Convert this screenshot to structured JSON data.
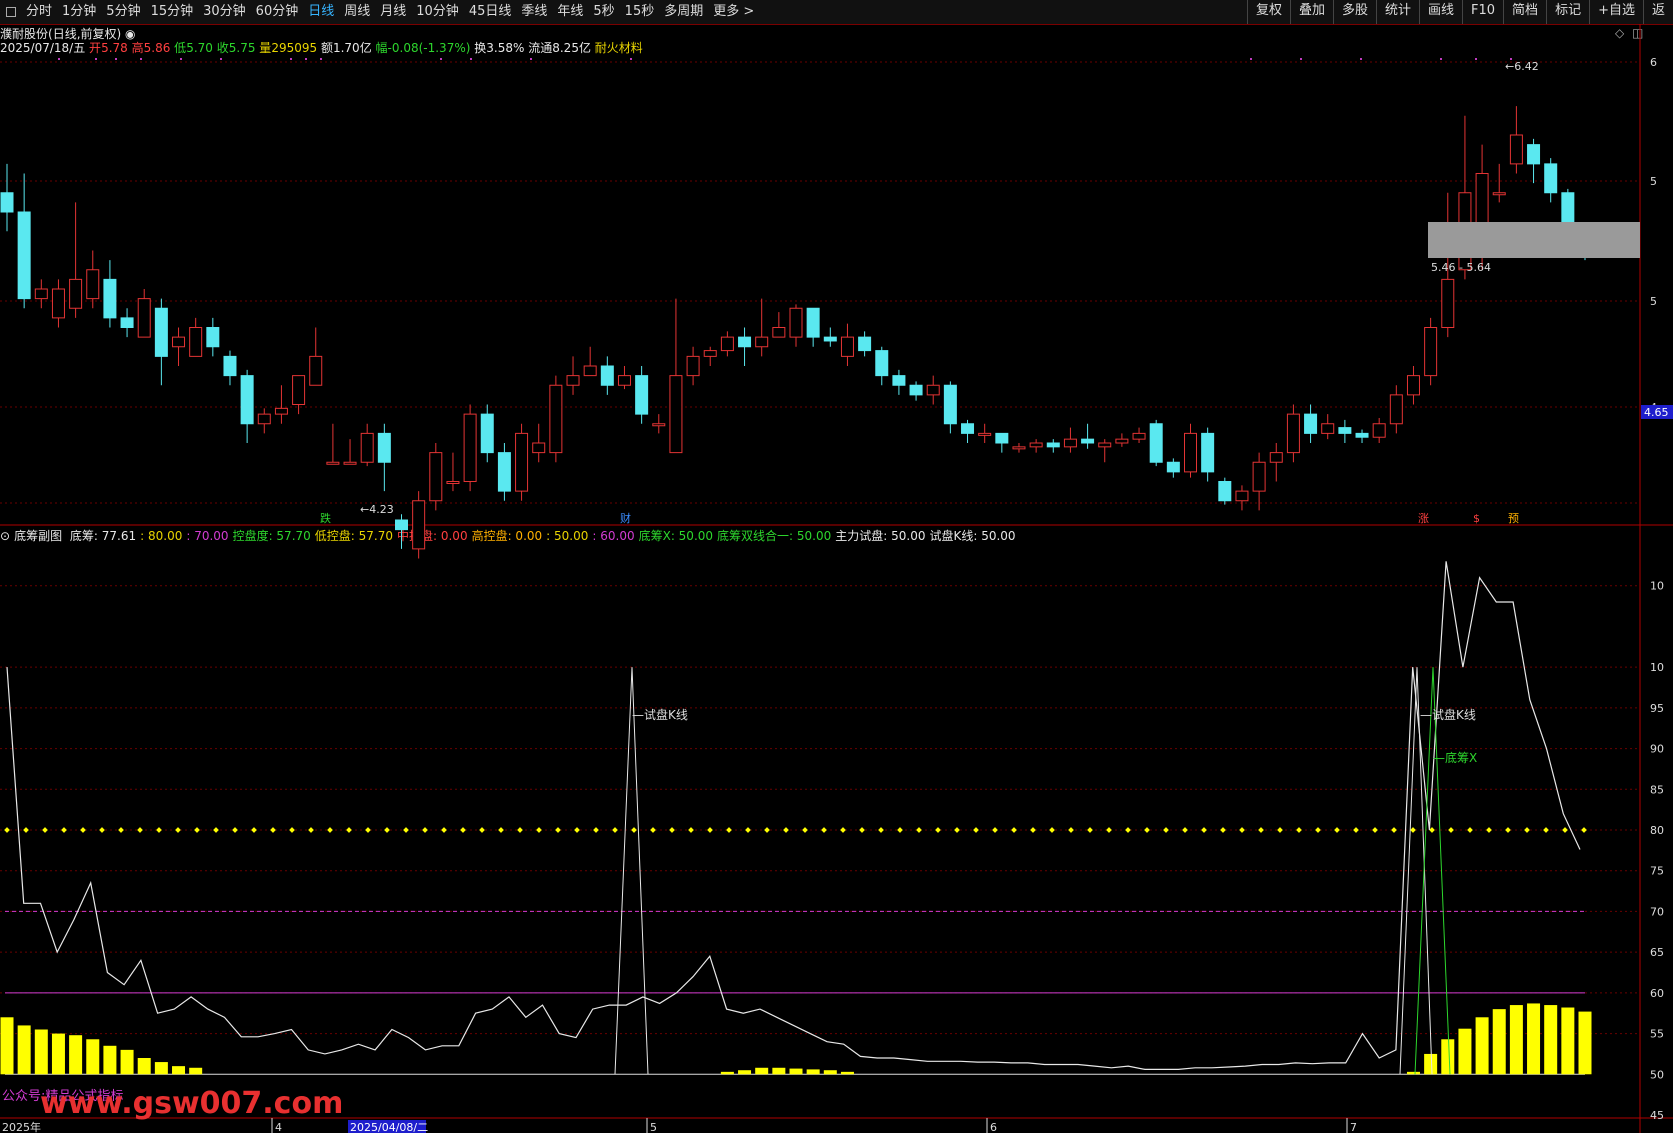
{
  "toolbar": {
    "periods": [
      "分时",
      "1分钟",
      "5分钟",
      "15分钟",
      "30分钟",
      "60分钟",
      "日线",
      "周线",
      "月线",
      "10分钟",
      "45日线",
      "季线",
      "年线",
      "5秒",
      "15秒",
      "多周期",
      "更多 >"
    ],
    "active": "日线",
    "right": [
      "复权",
      "叠加",
      "多股",
      "统计",
      "画线",
      "F10",
      "简档",
      "标记",
      "+自选",
      "返"
    ]
  },
  "stock": {
    "name": "濮耐股份",
    "mode": "(日线,前复权)",
    "date": "2025/07/18/五",
    "open_label": "开",
    "open": "5.78",
    "high_label": "高",
    "high": "5.86",
    "low_label": "低",
    "low": "5.70",
    "close_label": "收",
    "close": "5.75",
    "vol_label": "量",
    "vol": "295095",
    "amt_label": "额",
    "amt": "1.70亿",
    "chg_label": "幅",
    "chg": "-0.08(-1.37%)",
    "turnover_label": "换",
    "turnover": "3.58%",
    "float_label": "流通",
    "float": "8.25亿",
    "sector": "耐火材料"
  },
  "main_chart": {
    "price_labels": [
      "6",
      "5",
      "5",
      "4"
    ],
    "current_price": "4.65",
    "high_marker": "6.42",
    "low_marker": "4.23",
    "zone_label": "5.46 - 5.64",
    "markers": [
      "跌",
      "财",
      "涨",
      "$",
      "预"
    ],
    "y_domain": [
      4.1,
      6.5
    ],
    "candles": [
      [
        5.8,
        5.7,
        5.95,
        5.6
      ],
      [
        5.7,
        5.25,
        5.9,
        5.2
      ],
      [
        5.25,
        5.3,
        5.35,
        5.2
      ],
      [
        5.15,
        5.3,
        5.35,
        5.1
      ],
      [
        5.2,
        5.35,
        5.75,
        5.15
      ],
      [
        5.25,
        5.4,
        5.5,
        5.2
      ],
      [
        5.35,
        5.15,
        5.45,
        5.1
      ],
      [
        5.15,
        5.1,
        5.2,
        5.05
      ],
      [
        5.05,
        5.25,
        5.3,
        5.05
      ],
      [
        5.2,
        4.95,
        5.25,
        4.8
      ],
      [
        5.0,
        5.05,
        5.1,
        4.9
      ],
      [
        4.95,
        5.1,
        5.15,
        4.95
      ],
      [
        5.1,
        5.0,
        5.15,
        4.95
      ],
      [
        4.95,
        4.85,
        4.98,
        4.8
      ],
      [
        4.85,
        4.6,
        4.88,
        4.5
      ],
      [
        4.6,
        4.65,
        4.68,
        4.55
      ],
      [
        4.65,
        4.68,
        4.8,
        4.6
      ],
      [
        4.7,
        4.85,
        4.85,
        4.65
      ],
      [
        4.8,
        4.95,
        5.1,
        4.8
      ],
      [
        4.4,
        4.4,
        4.6,
        4.4
      ],
      [
        4.4,
        4.4,
        4.52,
        4.4
      ],
      [
        4.4,
        4.55,
        4.6,
        4.38
      ],
      [
        4.55,
        4.4,
        4.6,
        4.25
      ],
      [
        4.1,
        4.05,
        4.13,
        3.95
      ],
      [
        3.95,
        4.2,
        4.25,
        3.9
      ],
      [
        4.2,
        4.45,
        4.5,
        4.15
      ],
      [
        4.3,
        4.3,
        4.45,
        4.25
      ],
      [
        4.3,
        4.65,
        4.7,
        4.25
      ],
      [
        4.65,
        4.45,
        4.7,
        4.4
      ],
      [
        4.45,
        4.25,
        4.5,
        4.2
      ],
      [
        4.25,
        4.55,
        4.6,
        4.2
      ],
      [
        4.45,
        4.5,
        4.6,
        4.4
      ],
      [
        4.45,
        4.8,
        4.85,
        4.4
      ],
      [
        4.8,
        4.85,
        4.95,
        4.75
      ],
      [
        4.85,
        4.9,
        5.0,
        4.85
      ],
      [
        4.9,
        4.8,
        4.95,
        4.75
      ],
      [
        4.8,
        4.85,
        4.9,
        4.78
      ],
      [
        4.85,
        4.65,
        4.9,
        4.6
      ],
      [
        4.6,
        4.6,
        4.65,
        4.55
      ],
      [
        4.45,
        4.85,
        5.25,
        4.45
      ],
      [
        4.85,
        4.95,
        5.0,
        4.8
      ],
      [
        4.95,
        4.98,
        5.0,
        4.9
      ],
      [
        4.98,
        5.05,
        5.08,
        4.95
      ],
      [
        5.05,
        5.0,
        5.1,
        4.9
      ],
      [
        5.0,
        5.05,
        5.25,
        4.95
      ],
      [
        5.05,
        5.1,
        5.18,
        5.05
      ],
      [
        5.05,
        5.2,
        5.22,
        5.0
      ],
      [
        5.2,
        5.05,
        5.2,
        5.0
      ],
      [
        5.05,
        5.03,
        5.1,
        5.0
      ],
      [
        4.95,
        5.05,
        5.12,
        4.9
      ],
      [
        5.05,
        4.98,
        5.08,
        4.95
      ],
      [
        4.98,
        4.85,
        5.0,
        4.8
      ],
      [
        4.85,
        4.8,
        4.88,
        4.75
      ],
      [
        4.8,
        4.75,
        4.82,
        4.72
      ],
      [
        4.75,
        4.8,
        4.85,
        4.7
      ],
      [
        4.8,
        4.6,
        4.82,
        4.55
      ],
      [
        4.6,
        4.55,
        4.62,
        4.5
      ],
      [
        4.55,
        4.55,
        4.6,
        4.5
      ],
      [
        4.55,
        4.5,
        4.55,
        4.45
      ],
      [
        4.48,
        4.48,
        4.5,
        4.45
      ],
      [
        4.48,
        4.5,
        4.52,
        4.45
      ],
      [
        4.5,
        4.48,
        4.52,
        4.45
      ],
      [
        4.48,
        4.52,
        4.58,
        4.45
      ],
      [
        4.52,
        4.5,
        4.6,
        4.47
      ],
      [
        4.48,
        4.5,
        4.52,
        4.4
      ],
      [
        4.5,
        4.52,
        4.55,
        4.48
      ],
      [
        4.52,
        4.55,
        4.58,
        4.5
      ],
      [
        4.6,
        4.4,
        4.62,
        4.38
      ],
      [
        4.4,
        4.35,
        4.42,
        4.32
      ],
      [
        4.35,
        4.55,
        4.6,
        4.32
      ],
      [
        4.55,
        4.35,
        4.58,
        4.3
      ],
      [
        4.3,
        4.2,
        4.32,
        4.18
      ],
      [
        4.2,
        4.25,
        4.28,
        4.15
      ],
      [
        4.25,
        4.4,
        4.45,
        4.15
      ],
      [
        4.4,
        4.45,
        4.5,
        4.3
      ],
      [
        4.45,
        4.65,
        4.7,
        4.4
      ],
      [
        4.65,
        4.55,
        4.7,
        4.5
      ],
      [
        4.55,
        4.6,
        4.65,
        4.52
      ],
      [
        4.58,
        4.55,
        4.62,
        4.5
      ],
      [
        4.55,
        4.53,
        4.57,
        4.5
      ],
      [
        4.53,
        4.6,
        4.63,
        4.5
      ],
      [
        4.6,
        4.75,
        4.8,
        4.55
      ],
      [
        4.75,
        4.85,
        4.9,
        4.7
      ],
      [
        4.85,
        5.1,
        5.15,
        4.8
      ],
      [
        5.1,
        5.35,
        5.8,
        5.05
      ],
      [
        5.4,
        5.8,
        6.2,
        5.35
      ],
      [
        5.55,
        5.9,
        6.05,
        5.4
      ],
      [
        5.8,
        5.8,
        5.95,
        5.75
      ],
      [
        5.95,
        6.1,
        6.25,
        5.9
      ],
      [
        6.05,
        5.95,
        6.08,
        5.85
      ],
      [
        5.95,
        5.8,
        5.98,
        5.75
      ],
      [
        5.8,
        5.6,
        5.82,
        5.55
      ],
      [
        5.55,
        5.5,
        5.58,
        5.45
      ]
    ]
  },
  "indicator": {
    "title": "底筹副图",
    "items": [
      {
        "label": "底筹:",
        "value": "77.61",
        "color": "wht"
      },
      {
        "label": ":",
        "value": "80.00",
        "color": "yel"
      },
      {
        "label": ":",
        "value": "70.00",
        "color": "mag"
      },
      {
        "label": "控盘度:",
        "value": "57.70",
        "color": "grn"
      },
      {
        "label": "低控盘:",
        "value": "57.70",
        "color": "yel"
      },
      {
        "label": "中控盘:",
        "value": "0.00",
        "color": "red"
      },
      {
        "label": "高控盘:",
        "value": "0.00",
        "color": "org"
      },
      {
        "label": ":",
        "value": "50.00",
        "color": "yel"
      },
      {
        "label": ":",
        "value": "60.00",
        "color": "mag"
      },
      {
        "label": "底筹X:",
        "value": "50.00",
        "color": "grn"
      },
      {
        "label": "底筹双线合一:",
        "value": "50.00",
        "color": "grn"
      },
      {
        "label": "主力试盘:",
        "value": "50.00",
        "color": "wht"
      },
      {
        "label": "试盘K线:",
        "value": "50.00",
        "color": "wht"
      }
    ],
    "y_labels": [
      "10",
      "10",
      "95",
      "90",
      "85",
      "80",
      "75",
      "70",
      "65",
      "60",
      "55",
      "50",
      "45"
    ],
    "annotations": [
      "试盘K线",
      "试盘K线",
      "底筹X"
    ],
    "watermark_small": "公众号:精品公式指标",
    "watermark_big": "www.gsw007.com",
    "chips": [
      57,
      56,
      55.5,
      55,
      54.8,
      54.3,
      53.5,
      53,
      52,
      51.5,
      51,
      50.8
    ],
    "chips_mid": [
      50.3,
      50.5,
      50.8,
      50.8,
      50.7,
      50.6,
      50.5,
      50.3
    ],
    "chips_end": [
      50.3,
      52.5,
      54.3,
      55.6,
      57,
      58,
      58.5,
      58.7,
      58.5,
      58.2,
      57.7
    ],
    "line": [
      100,
      71,
      71,
      65,
      69,
      73.5,
      62.5,
      61,
      64,
      57.5,
      58,
      59.5,
      58,
      57,
      54.6,
      54.6,
      55,
      55.5,
      53,
      52.5,
      53,
      53.7,
      53,
      55.5,
      54.5,
      53,
      53.5,
      53.5,
      57.5,
      58,
      59.5,
      57,
      58.5,
      55,
      54.5,
      58,
      58.5,
      58.5,
      59.5,
      58.7,
      60,
      62,
      64.5,
      58,
      57.5,
      58,
      57,
      56,
      55,
      54,
      53.7,
      52.2,
      52,
      52,
      51.8,
      51.6,
      51.6,
      51.6,
      51.5,
      51.5,
      51.4,
      51.4,
      51.2,
      51.2,
      51.2,
      51,
      50.8,
      51,
      50.6,
      50.6,
      50.6,
      50.8,
      50.8,
      50.9,
      51,
      51.2,
      51.2,
      51.4,
      51.3,
      51.4,
      51.4,
      55,
      52,
      53,
      100,
      80,
      113,
      100,
      111,
      108,
      108,
      96,
      90,
      82,
      77.6
    ]
  },
  "xaxis": {
    "labels": [
      "2025年",
      "4",
      "2025/04/08/二",
      "5",
      "6",
      "7"
    ]
  },
  "colors": {
    "up": "#e43434",
    "down": "#5ae8f0",
    "grid": "#6a0000",
    "axis": "#b00000"
  }
}
